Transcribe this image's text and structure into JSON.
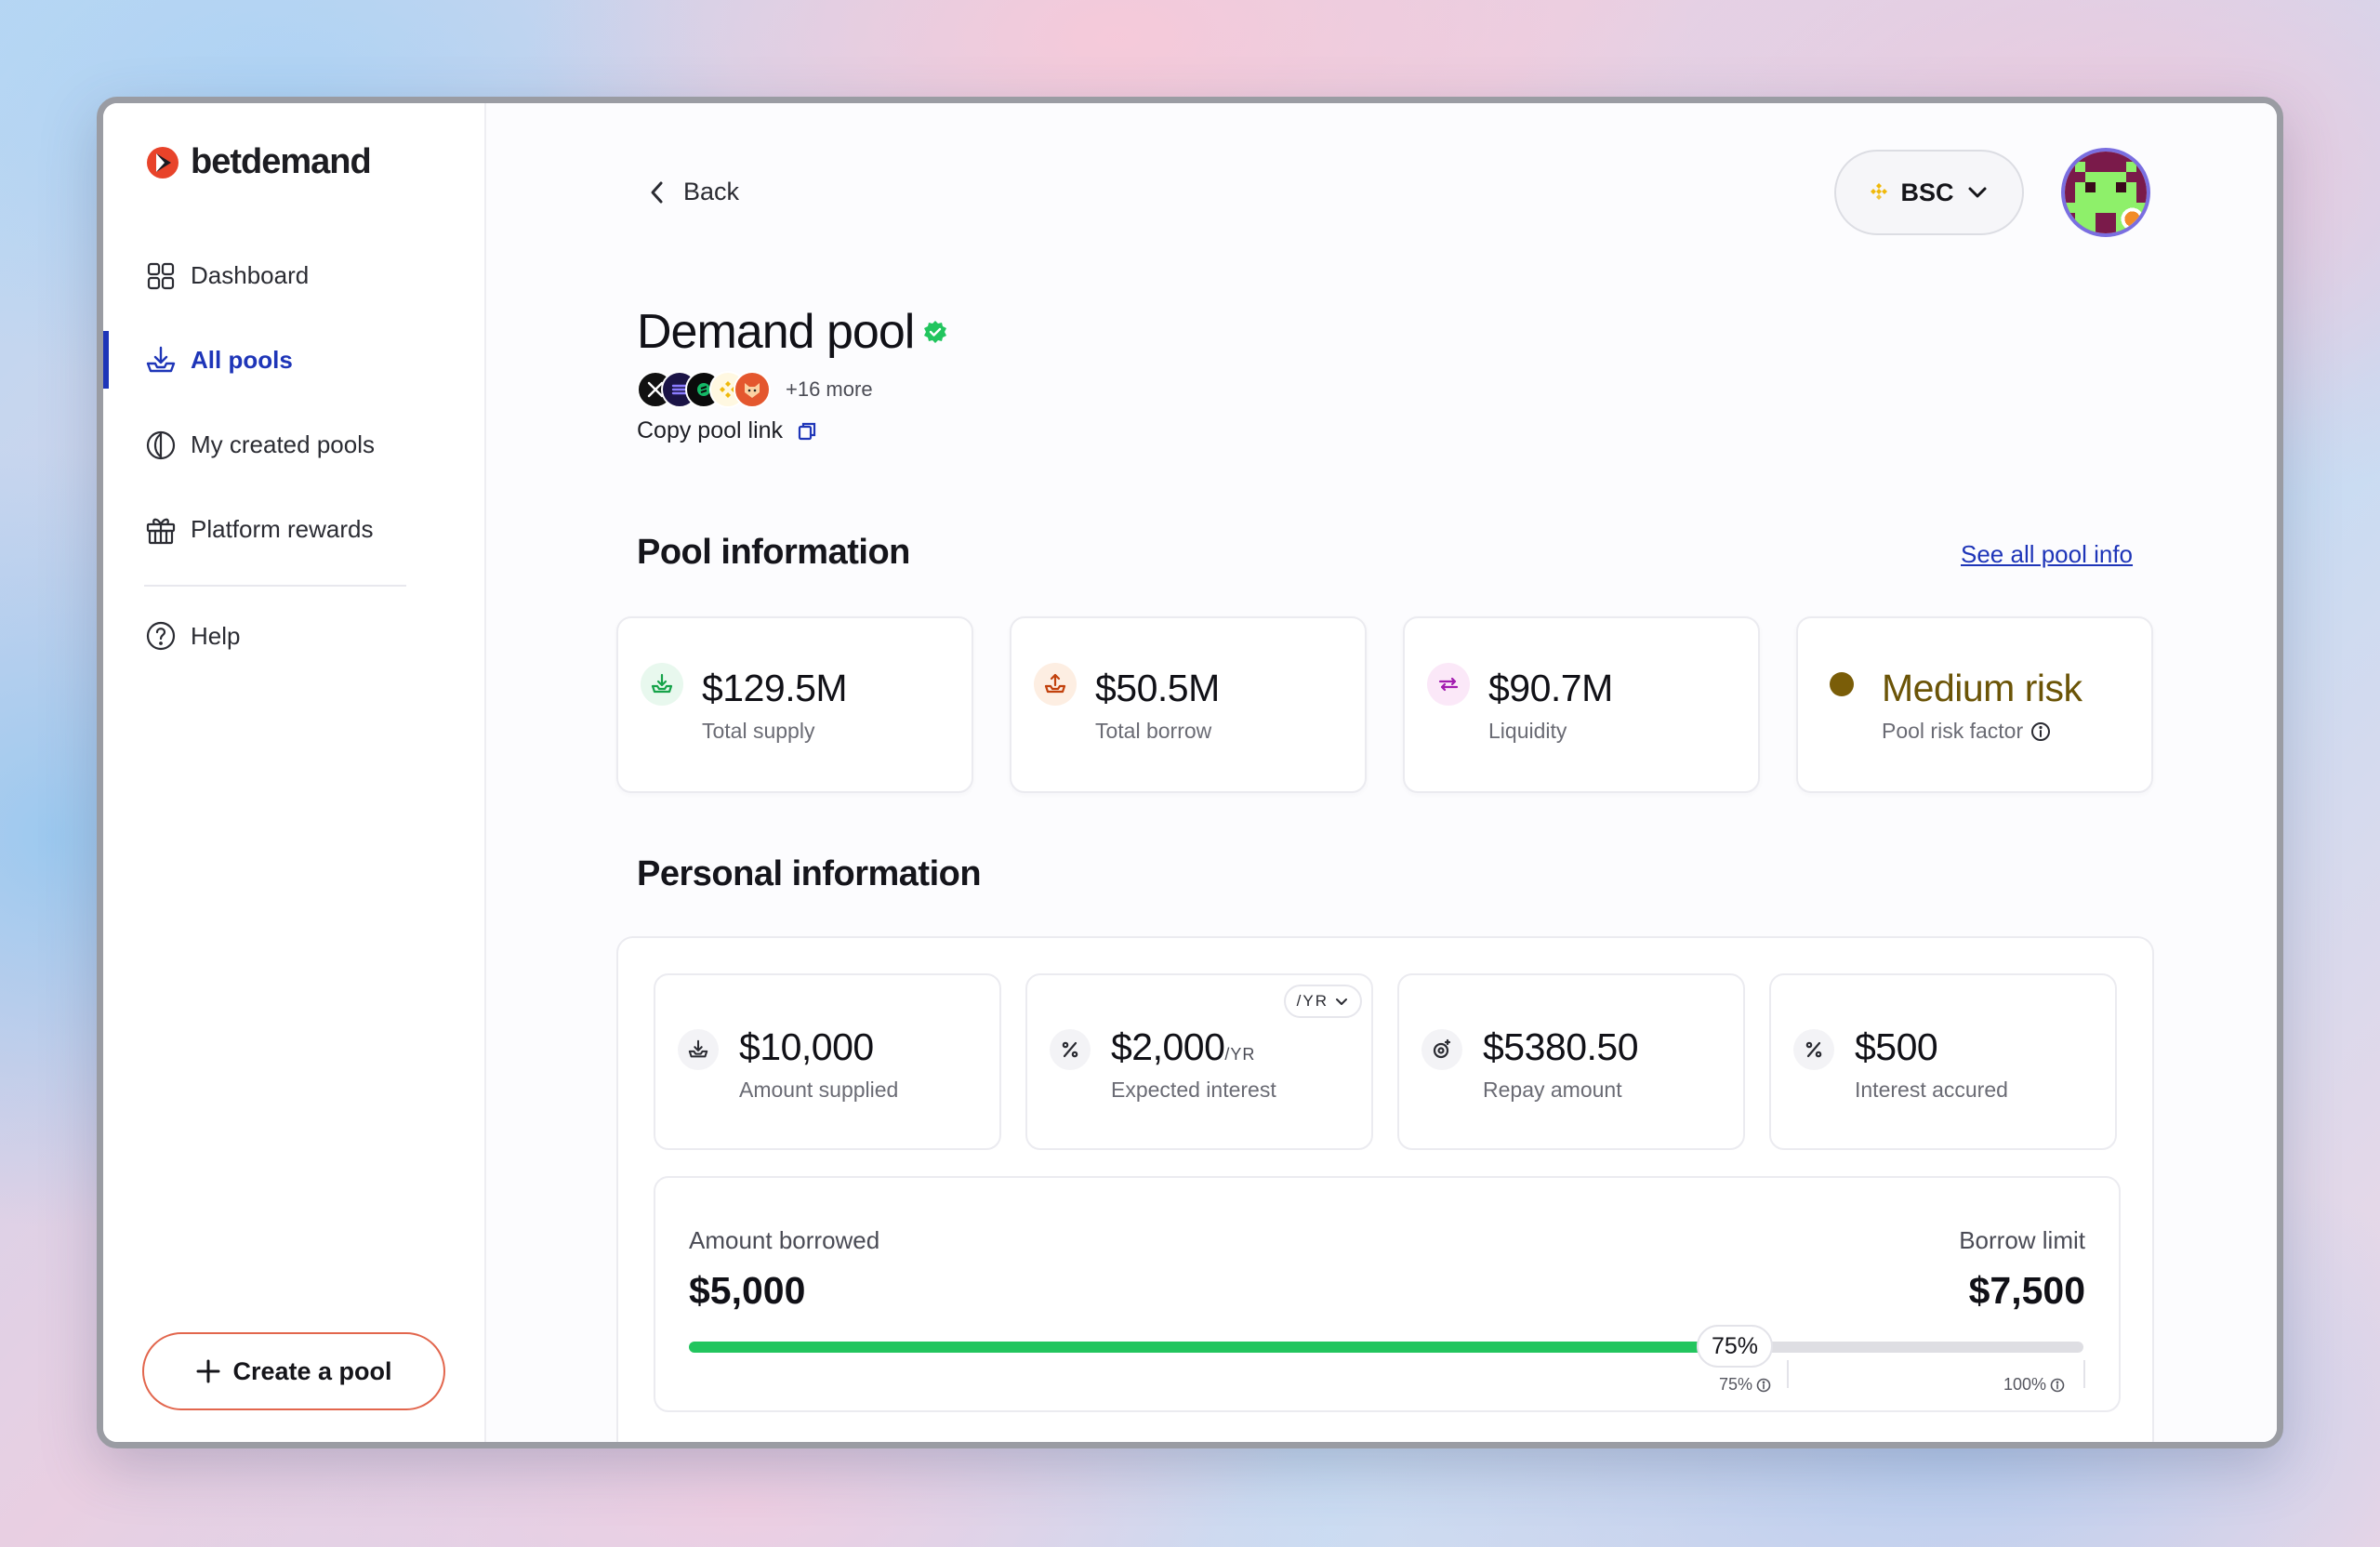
{
  "brand": {
    "name": "betdemand",
    "accent": "#1e35b8",
    "logo_color": "#e8432a"
  },
  "sidebar": {
    "items": [
      {
        "label": "Dashboard",
        "icon": "grid-icon",
        "active": false
      },
      {
        "label": "All pools",
        "icon": "download-tray-icon",
        "active": true
      },
      {
        "label": "My created pools",
        "icon": "half-circle-icon",
        "active": false
      },
      {
        "label": "Platform rewards",
        "icon": "gift-icon",
        "active": false
      }
    ],
    "help": {
      "label": "Help",
      "icon": "question-circle-icon"
    },
    "create_label": "Create a pool"
  },
  "header": {
    "back_label": "Back",
    "network": "BSC"
  },
  "pool": {
    "name": "Demand pool",
    "verified": true,
    "tokens_more": "+16 more",
    "copy_link_label": "Copy pool link"
  },
  "pool_info": {
    "title": "Pool information",
    "see_all_label": "See all pool info",
    "cards": [
      {
        "value": "$129.5M",
        "label": "Total supply",
        "color": "#16a34a"
      },
      {
        "value": "$50.5M",
        "label": "Total borrow",
        "color": "#c2410c"
      },
      {
        "value": "$90.7M",
        "label": "Liquidity",
        "color": "#a21caf"
      },
      {
        "value": "Medium risk",
        "label": "Pool risk factor",
        "color": "#7a5d08"
      }
    ]
  },
  "personal_info": {
    "title": "Personal information",
    "period_selector": "/YR",
    "cards": [
      {
        "value": "$10,000",
        "suffix": "",
        "label": "Amount supplied"
      },
      {
        "value": "$2,000",
        "suffix": "/YR",
        "label": "Expected interest"
      },
      {
        "value": "$5380.50",
        "suffix": "",
        "label": "Repay amount"
      },
      {
        "value": "$500",
        "suffix": "",
        "label": "Interest accured"
      }
    ],
    "borrow": {
      "amount_label": "Amount borrowed",
      "amount_value": "$5,000",
      "limit_label": "Borrow limit",
      "limit_value": "$7,500",
      "progress": 0.75,
      "progress_label": "75%",
      "tick_75": "75%",
      "tick_100": "100%",
      "fill_color": "#22c55e"
    }
  }
}
